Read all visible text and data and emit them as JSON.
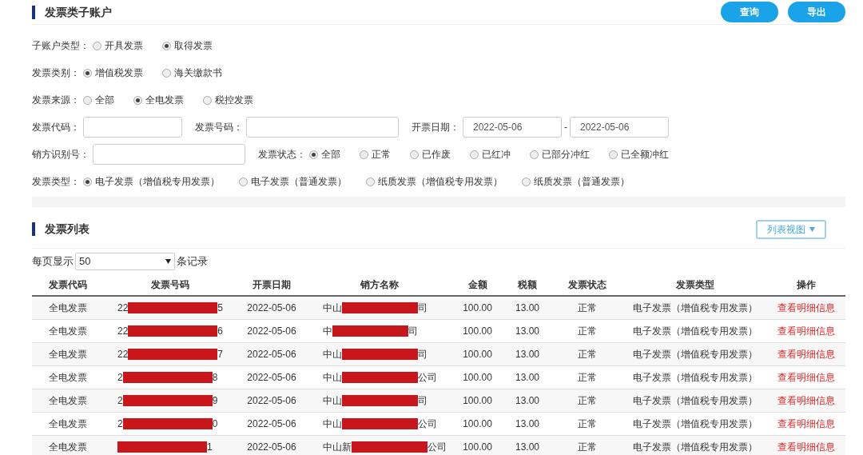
{
  "filter_panel": {
    "title": "发票类子账户",
    "buttons": [
      {
        "label": "查询"
      },
      {
        "label": "导出"
      }
    ],
    "rows": [
      {
        "items": [
          {
            "kind": "radio_group",
            "label": "子账户类型：",
            "options": [
              {
                "label": "开具发票",
                "selected": false
              },
              {
                "label": "取得发票",
                "selected": true
              }
            ]
          }
        ]
      },
      {
        "items": [
          {
            "kind": "radio_group",
            "label": "发票类别：",
            "options": [
              {
                "label": "增值税发票",
                "selected": true
              },
              {
                "label": "海关缴款书",
                "selected": false
              }
            ]
          }
        ]
      },
      {
        "items": [
          {
            "kind": "radio_group",
            "label": "发票来源：",
            "options": [
              {
                "label": "全部",
                "selected": false
              },
              {
                "label": "全电发票",
                "selected": true
              },
              {
                "label": "税控发票",
                "selected": false
              }
            ]
          }
        ]
      },
      {
        "items": [
          {
            "kind": "field",
            "label": "发票代码："
          },
          {
            "kind": "field",
            "label": "发票号码：",
            "wide": true
          },
          {
            "kind": "date_range",
            "label": "开票日期：",
            "from": "2022-05-06",
            "separator": "-",
            "to": "2022-05-06"
          }
        ]
      },
      {
        "items": [
          {
            "kind": "field",
            "label": "销方识别号：",
            "wide": true
          },
          {
            "kind": "radio_group",
            "label": "发票状态：",
            "options": [
              {
                "label": "全部",
                "selected": true
              },
              {
                "label": "正常",
                "selected": false
              },
              {
                "label": "已作废",
                "selected": false
              },
              {
                "label": "已红冲",
                "selected": false
              },
              {
                "label": "已部分冲红",
                "selected": false
              },
              {
                "label": "已全额冲红",
                "selected": false
              }
            ]
          }
        ]
      },
      {
        "items": [
          {
            "kind": "radio_group",
            "label": "发票类型：",
            "options": [
              {
                "label": "电子发票（增值税专用发票）",
                "selected": true
              },
              {
                "label": "电子发票（普通发票）",
                "selected": false
              },
              {
                "label": "纸质发票（增值税专用发票）",
                "selected": false
              },
              {
                "label": "纸质发票（普通发票）",
                "selected": false
              }
            ]
          }
        ]
      }
    ]
  },
  "list_panel": {
    "title": "发票列表",
    "view_select": "列表视图",
    "page_size": {
      "before": "每页显示",
      "value": "50",
      "after": "条记录"
    },
    "table": {
      "columns": [
        "发票代码",
        "发票号码",
        "开票日期",
        "销方名称",
        "金额",
        "税额",
        "发票状态",
        "发票类型",
        "操作"
      ],
      "rows": [
        {
          "code": "全电发票",
          "number": {
            "prefix": "22",
            "suffix": "5"
          },
          "date": "2022-05-06",
          "seller": {
            "prefix": "中山",
            "suffix": "司"
          },
          "amount": "100.00",
          "tax": "13.00",
          "status": "正常",
          "type": "电子发票（增值税专用发票）",
          "action": "查看明细信息"
        },
        {
          "code": "全电发票",
          "number": {
            "prefix": "22",
            "suffix": "6"
          },
          "date": "2022-05-06",
          "seller": {
            "prefix": "中",
            "suffix": "司"
          },
          "amount": "100.00",
          "tax": "13.00",
          "status": "正常",
          "type": "电子发票（增值税专用发票）",
          "action": "查看明细信息"
        },
        {
          "code": "全电发票",
          "number": {
            "prefix": "22",
            "suffix": "7"
          },
          "date": "2022-05-06",
          "seller": {
            "prefix": "中山",
            "suffix": "司"
          },
          "amount": "100.00",
          "tax": "13.00",
          "status": "正常",
          "type": "电子发票（增值税专用发票）",
          "action": "查看明细信息"
        },
        {
          "code": "全电发票",
          "number": {
            "prefix": "2",
            "suffix": "8"
          },
          "date": "2022-05-06",
          "seller": {
            "prefix": "中山",
            "suffix": "公司"
          },
          "amount": "100.00",
          "tax": "13.00",
          "status": "正常",
          "type": "电子发票（增值税专用发票）",
          "action": "查看明细信息"
        },
        {
          "code": "全电发票",
          "number": {
            "prefix": "2",
            "suffix": "9"
          },
          "date": "2022-05-06",
          "seller": {
            "prefix": "中山",
            "suffix": "司"
          },
          "amount": "100.00",
          "tax": "13.00",
          "status": "正常",
          "type": "电子发票（增值税专用发票）",
          "action": "查看明细信息"
        },
        {
          "code": "全电发票",
          "number": {
            "prefix": "2",
            "suffix": "0"
          },
          "date": "2022-05-06",
          "seller": {
            "prefix": "中山",
            "suffix": "公司"
          },
          "amount": "100.00",
          "tax": "13.00",
          "status": "正常",
          "type": "电子发票（增值税专用发票）",
          "action": "查看明细信息"
        },
        {
          "code": "全电发票",
          "number": {
            "suffix": "1"
          },
          "date": "2022-05-06",
          "seller": {
            "prefix": "中山新",
            "suffix": "公司"
          },
          "amount": "100.00",
          "tax": "13.00",
          "status": "正常",
          "type": "电子发票（增值税专用发票）",
          "action": "查看明细信息"
        }
      ]
    }
  }
}
